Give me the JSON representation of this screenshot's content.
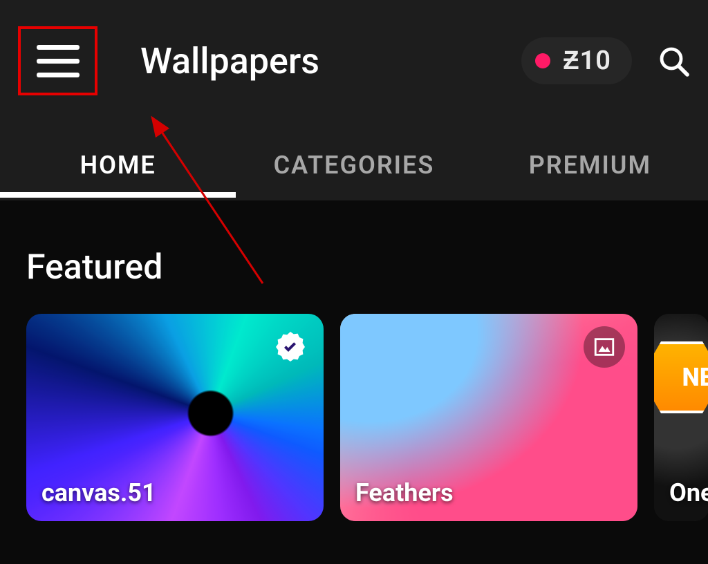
{
  "header": {
    "title": "Wallpapers",
    "credits_label": "Ƶ10",
    "menu_highlighted": true
  },
  "tabs": [
    {
      "label": "HOME",
      "active": true
    },
    {
      "label": "CATEGORIES",
      "active": false
    },
    {
      "label": "PREMIUM",
      "active": false
    }
  ],
  "featured": {
    "heading": "Featured",
    "cards": [
      {
        "title": "canvas.51",
        "badge": "verified"
      },
      {
        "title": "Feathers",
        "badge": "image"
      },
      {
        "title": "One",
        "badge": "new",
        "badge_text": "NE"
      }
    ]
  },
  "icons": {
    "menu": "hamburger-icon",
    "search": "search-icon",
    "verified": "verified-badge-icon",
    "image": "image-icon"
  },
  "annotation": {
    "type": "highlight-and-arrow",
    "target": "menu-button",
    "highlight_color": "#e60000",
    "arrow_color": "#d40000"
  }
}
